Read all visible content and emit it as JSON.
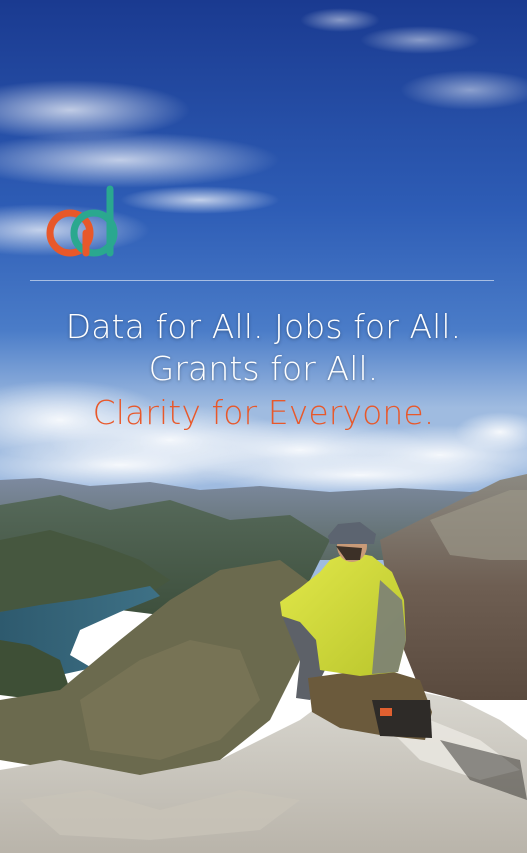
{
  "hero": {
    "line1": "Data for All. Jobs for All.",
    "line2": "Grants for All.",
    "tagline": "Clarity for Everyone."
  },
  "colors": {
    "sky_top": "#1d3f96",
    "sky_mid": "#3a6dc2",
    "accent_orange": "#e8582a",
    "logo_green": "#2aa88f",
    "jacket_yellow": "#d8e040",
    "text_white": "#ffffff"
  },
  "logo": {
    "icon": "ad-logo-icon"
  }
}
